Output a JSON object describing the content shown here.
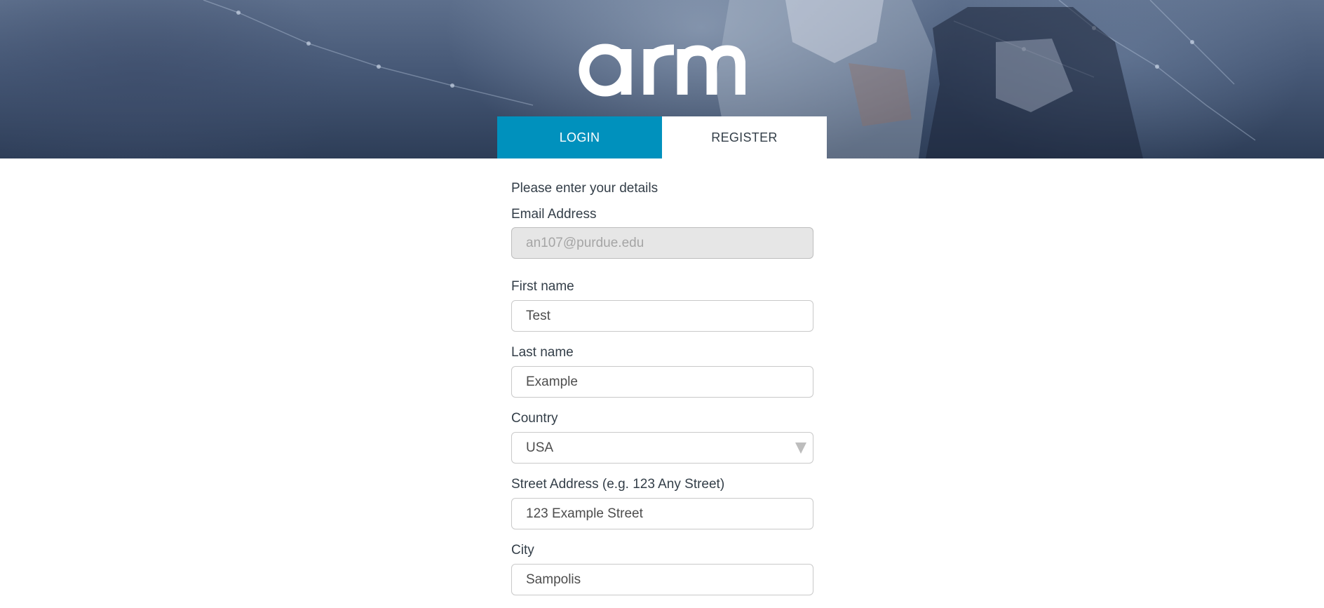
{
  "brand": {
    "logo_text": "arm"
  },
  "tabs": [
    {
      "label": "LOGIN",
      "active": true
    },
    {
      "label": "REGISTER",
      "active": false
    }
  ],
  "form": {
    "intro": "Please enter your details",
    "email": {
      "label": "Email Address",
      "value": "an107@purdue.edu",
      "disabled": true
    },
    "first_name": {
      "label": "First name",
      "value": "Test"
    },
    "last_name": {
      "label": "Last name",
      "value": "Example"
    },
    "country": {
      "label": "Country",
      "value": "USA"
    },
    "street": {
      "label": "Street Address (e.g. 123 Any Street)",
      "value": "123 Example Street"
    },
    "city": {
      "label": "City",
      "value": "Sampolis"
    }
  },
  "colors": {
    "accent": "#0091bd",
    "text": "#333e48",
    "input_text": "#4d4d4d",
    "disabled_bg": "#e6e6e6"
  },
  "icons": {
    "select_arrow": "triangle-down-icon"
  }
}
